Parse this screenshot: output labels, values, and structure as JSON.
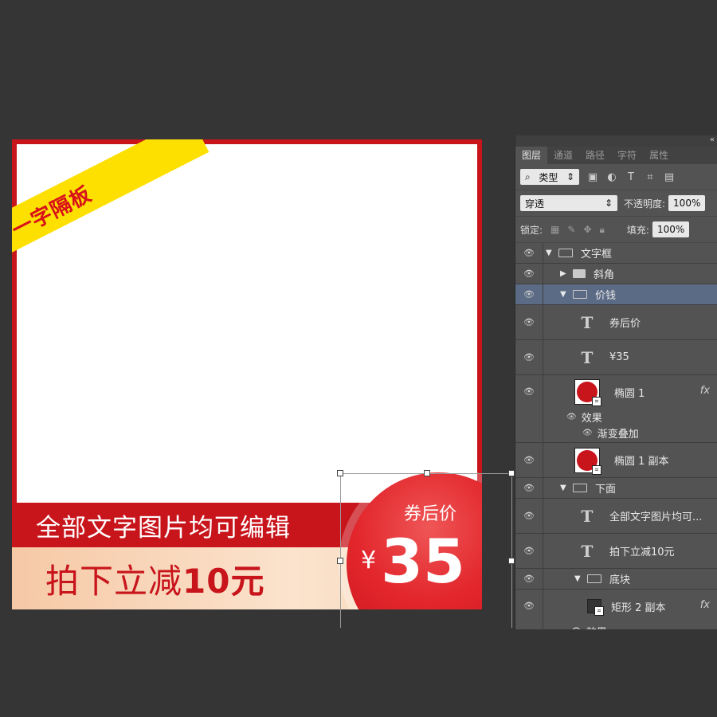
{
  "artwork": {
    "ribbon_text": "一字隔板",
    "banner_text": "全部文字图片均可编辑",
    "discount_text_prefix": "拍下立减",
    "discount_text_bold": "10元",
    "coupon_label": "券后价",
    "currency_symbol": "¥",
    "price": "35",
    "colors": {
      "red": "#c8141b",
      "yellow": "#fde000",
      "peach": "#f8d5b6"
    }
  },
  "layers_panel": {
    "collapse_icon": "«",
    "tabs": [
      "图层",
      "通道",
      "路径",
      "字符",
      "属性"
    ],
    "filter_kind": "类型",
    "blend_mode": "穿透",
    "opacity_label": "不透明度:",
    "opacity_value": "100%",
    "lock_label": "锁定:",
    "fill_label": "填充:",
    "fill_value": "100%",
    "fx_label": "fx",
    "layers": [
      {
        "name": "文字框",
        "kind": "group-open",
        "indent": 0
      },
      {
        "name": "斜角",
        "kind": "group-closed",
        "indent": 1
      },
      {
        "name": "价钱",
        "kind": "group-open",
        "indent": 1,
        "selected": true
      },
      {
        "name": "券后价",
        "kind": "text",
        "indent": 2
      },
      {
        "name": "¥35",
        "kind": "text",
        "indent": 2
      },
      {
        "name": "椭圆 1",
        "kind": "shape",
        "indent": 2,
        "fx": true,
        "effects_label": "效果",
        "effect": "渐变叠加"
      },
      {
        "name": "椭圆 1 副本",
        "kind": "shape",
        "indent": 2
      },
      {
        "name": "下面",
        "kind": "group-open",
        "indent": 1
      },
      {
        "name": "全部文字图片均可...",
        "kind": "text",
        "indent": 2
      },
      {
        "name": "拍下立减10元",
        "kind": "text",
        "indent": 2
      },
      {
        "name": "底块",
        "kind": "group-open",
        "indent": 2
      },
      {
        "name": "矩形 2 副本",
        "kind": "rect",
        "indent": 3,
        "fx": true,
        "effects_label": "效果"
      }
    ]
  }
}
